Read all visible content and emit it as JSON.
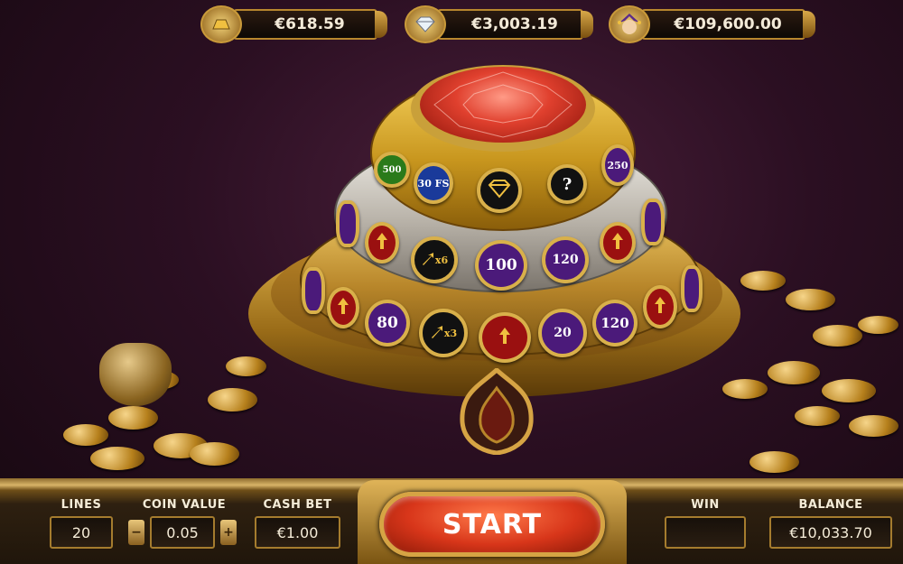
{
  "jackpots": [
    {
      "icon": "gold-bar-icon",
      "amount": "€618.59"
    },
    {
      "icon": "diamond-icon",
      "amount": "€3,003.19"
    },
    {
      "icon": "jester-icon",
      "amount": "€109,600.00"
    }
  ],
  "wheel": {
    "top_tier": [
      "500",
      "30 FS",
      "diamond",
      "?",
      "250"
    ],
    "middle_tier": [
      "arrow",
      "x6",
      "100",
      "120",
      "arrow"
    ],
    "bottom_tier": [
      "arrow",
      "80",
      "x3",
      "arrow",
      "20",
      "120",
      "arrow"
    ]
  },
  "controls": {
    "lines_label": "LINES",
    "lines_value": "20",
    "coin_value_label": "COIN VALUE",
    "coin_value": "0.05",
    "minus": "−",
    "plus": "+",
    "cash_bet_label": "CASH BET",
    "cash_bet_value": "€1.00",
    "start_label": "START",
    "win_label": "WIN",
    "win_value": "",
    "balance_label": "BALANCE",
    "balance_value": "€10,033.70"
  },
  "colors": {
    "start": "#d8361a",
    "gold": "#d9b04a",
    "purple_token": "#4b1a7a",
    "red_token": "#9a1010",
    "blue_token": "#1a3a9a"
  }
}
